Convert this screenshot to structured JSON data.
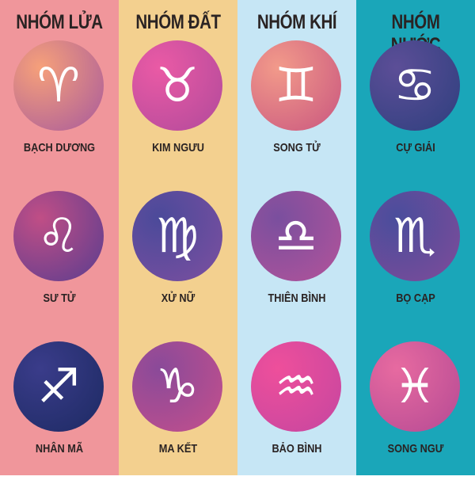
{
  "groups": [
    {
      "title": "NHÓM LỬA",
      "bg": "#f0969b",
      "signs": [
        {
          "name": "BẠCH DƯƠNG",
          "icon": "aries-icon",
          "glyph": "♈",
          "grad": [
            "#f6a07a",
            "#a85a9c"
          ]
        },
        {
          "name": "SƯ TỬ",
          "icon": "leo-icon",
          "glyph": "♌",
          "grad": [
            "#c04e86",
            "#5a3d8f"
          ]
        },
        {
          "name": "NHÂN MÃ",
          "icon": "sagittarius-icon",
          "glyph": "♐",
          "grad": [
            "#3a3c8a",
            "#1d2a63"
          ]
        }
      ]
    },
    {
      "title": "NHÓM ĐẤT",
      "bg": "#f3d08f",
      "signs": [
        {
          "name": "KIM NGƯU",
          "icon": "taurus-icon",
          "glyph": "♉",
          "grad": [
            "#ea5aa5",
            "#b14a9b"
          ]
        },
        {
          "name": "XỬ NỮ",
          "icon": "virgo-icon",
          "glyph": "♍",
          "grad": [
            "#4b4a9a",
            "#7d4fa0"
          ]
        },
        {
          "name": "MA KẾT",
          "icon": "capricorn-icon",
          "glyph": "♑",
          "grad": [
            "#8a4a99",
            "#c54f8c"
          ]
        }
      ]
    },
    {
      "title": "NHÓM KHÍ",
      "bg": "#c6e6f5",
      "signs": [
        {
          "name": "SONG TỬ",
          "icon": "gemini-icon",
          "glyph": "♊",
          "grad": [
            "#f29a8a",
            "#c9567f"
          ]
        },
        {
          "name": "THIÊN BÌNH",
          "icon": "libra-icon",
          "glyph": "♎",
          "grad": [
            "#7a4f9e",
            "#b3539a"
          ]
        },
        {
          "name": "BẢO BÌNH",
          "icon": "aquarius-icon",
          "glyph": "♒",
          "grad": [
            "#ee4f9b",
            "#c546a0"
          ]
        }
      ]
    },
    {
      "title": "NHÓM NƯỚC",
      "bg": "#1aa6b9",
      "signs": [
        {
          "name": "CỰ GIẢI",
          "icon": "cancer-icon",
          "glyph": "♋",
          "grad": [
            "#5c4e97",
            "#2e3f7e"
          ]
        },
        {
          "name": "BỌ CẠP",
          "icon": "scorpio-icon",
          "glyph": "♏",
          "grad": [
            "#4a4d9c",
            "#7f4c99"
          ]
        },
        {
          "name": "SONG NGƯ",
          "icon": "pisces-icon",
          "glyph": "♓",
          "grad": [
            "#e76aa0",
            "#b54a94"
          ]
        }
      ]
    }
  ]
}
